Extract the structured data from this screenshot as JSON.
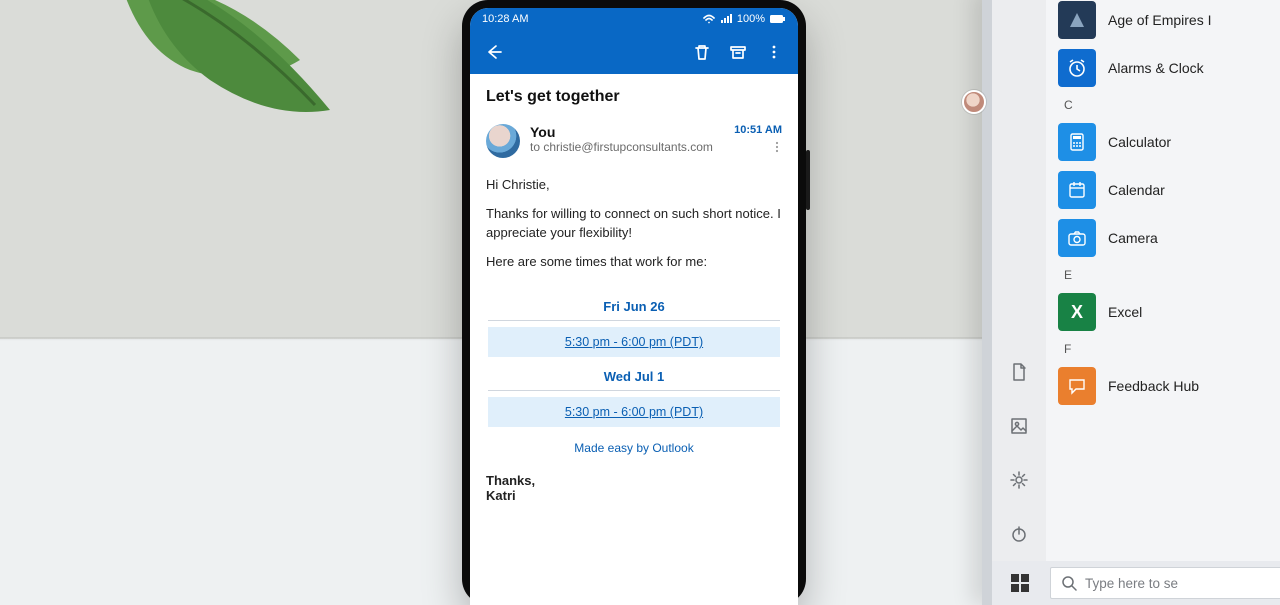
{
  "phone": {
    "status": {
      "time": "10:28 AM",
      "battery": "100%"
    },
    "email": {
      "subject": "Let's get together",
      "sender_name": "You",
      "to_line": "to christie@firstupconsultants.com",
      "received_time": "10:51 AM",
      "greeting": "Hi Christie,",
      "p1": "Thanks for willing to connect on such short notice. I appreciate your flexibility!",
      "p2": "Here are some times that work for me:",
      "availability": [
        {
          "day": "Fri Jun 26",
          "slot": "5:30 pm - 6:00 pm (PDT)"
        },
        {
          "day": "Wed Jul 1",
          "slot": "5:30 pm - 6:00 pm (PDT)"
        }
      ],
      "made_easy": "Made easy by Outlook",
      "sig_thanks": "Thanks,",
      "sig_name": "Katri"
    }
  },
  "windows": {
    "apps": [
      {
        "label": "Age of Empires I",
        "color": "#233a57",
        "letter": ""
      },
      {
        "label": "Alarms & Clock",
        "color": "#0f6ccf",
        "letter": ""
      },
      {
        "label": "Calculator",
        "color": "#1e8fe6",
        "letter": ""
      },
      {
        "label": "Calendar",
        "color": "#1e8fe6",
        "letter": ""
      },
      {
        "label": "Camera",
        "color": "#1e8fe6",
        "letter": ""
      },
      {
        "label": "Excel",
        "color": "#188245",
        "letter": "X"
      },
      {
        "label": "Feedback Hub",
        "color": "#ea7f2e",
        "letter": ""
      }
    ],
    "categories": {
      "c": "C",
      "e": "E",
      "f": "F"
    },
    "search_placeholder": "Type here to se"
  }
}
